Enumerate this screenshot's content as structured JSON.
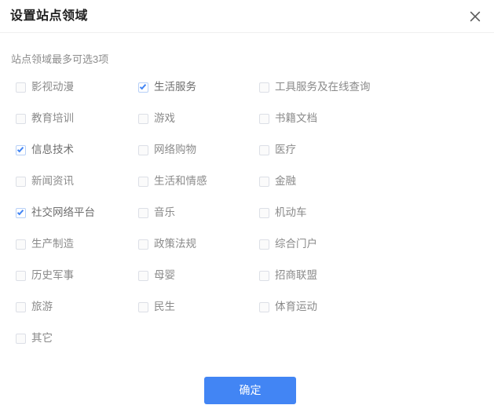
{
  "dialog": {
    "title": "设置站点领域",
    "hint": "站点领域最多可选3项",
    "close_icon": "close-icon",
    "max_selectable": 3,
    "accent_color": "#4285f4",
    "label_color": "#8a8a8a",
    "title_color": "#1f1f1f",
    "hint_color": "#8c8c8c"
  },
  "options": [
    [
      {
        "label": "影视动漫",
        "checked": false
      },
      {
        "label": "生活服务",
        "checked": true
      },
      {
        "label": "工具服务及在线查询",
        "checked": false
      }
    ],
    [
      {
        "label": "教育培训",
        "checked": false
      },
      {
        "label": "游戏",
        "checked": false
      },
      {
        "label": "书籍文档",
        "checked": false
      }
    ],
    [
      {
        "label": "信息技术",
        "checked": true
      },
      {
        "label": "网络购物",
        "checked": false
      },
      {
        "label": "医疗",
        "checked": false
      }
    ],
    [
      {
        "label": "新闻资讯",
        "checked": false
      },
      {
        "label": "生活和情感",
        "checked": false
      },
      {
        "label": "金融",
        "checked": false
      }
    ],
    [
      {
        "label": "社交网络平台",
        "checked": true
      },
      {
        "label": "音乐",
        "checked": false
      },
      {
        "label": "机动车",
        "checked": false
      }
    ],
    [
      {
        "label": "生产制造",
        "checked": false
      },
      {
        "label": "政策法规",
        "checked": false
      },
      {
        "label": "综合门户",
        "checked": false
      }
    ],
    [
      {
        "label": "历史军事",
        "checked": false
      },
      {
        "label": "母婴",
        "checked": false
      },
      {
        "label": "招商联盟",
        "checked": false
      }
    ],
    [
      {
        "label": "旅游",
        "checked": false
      },
      {
        "label": "民生",
        "checked": false
      },
      {
        "label": "体育运动",
        "checked": false
      }
    ],
    [
      {
        "label": "其它",
        "checked": false
      }
    ]
  ],
  "footer": {
    "confirm_label": "确定"
  }
}
